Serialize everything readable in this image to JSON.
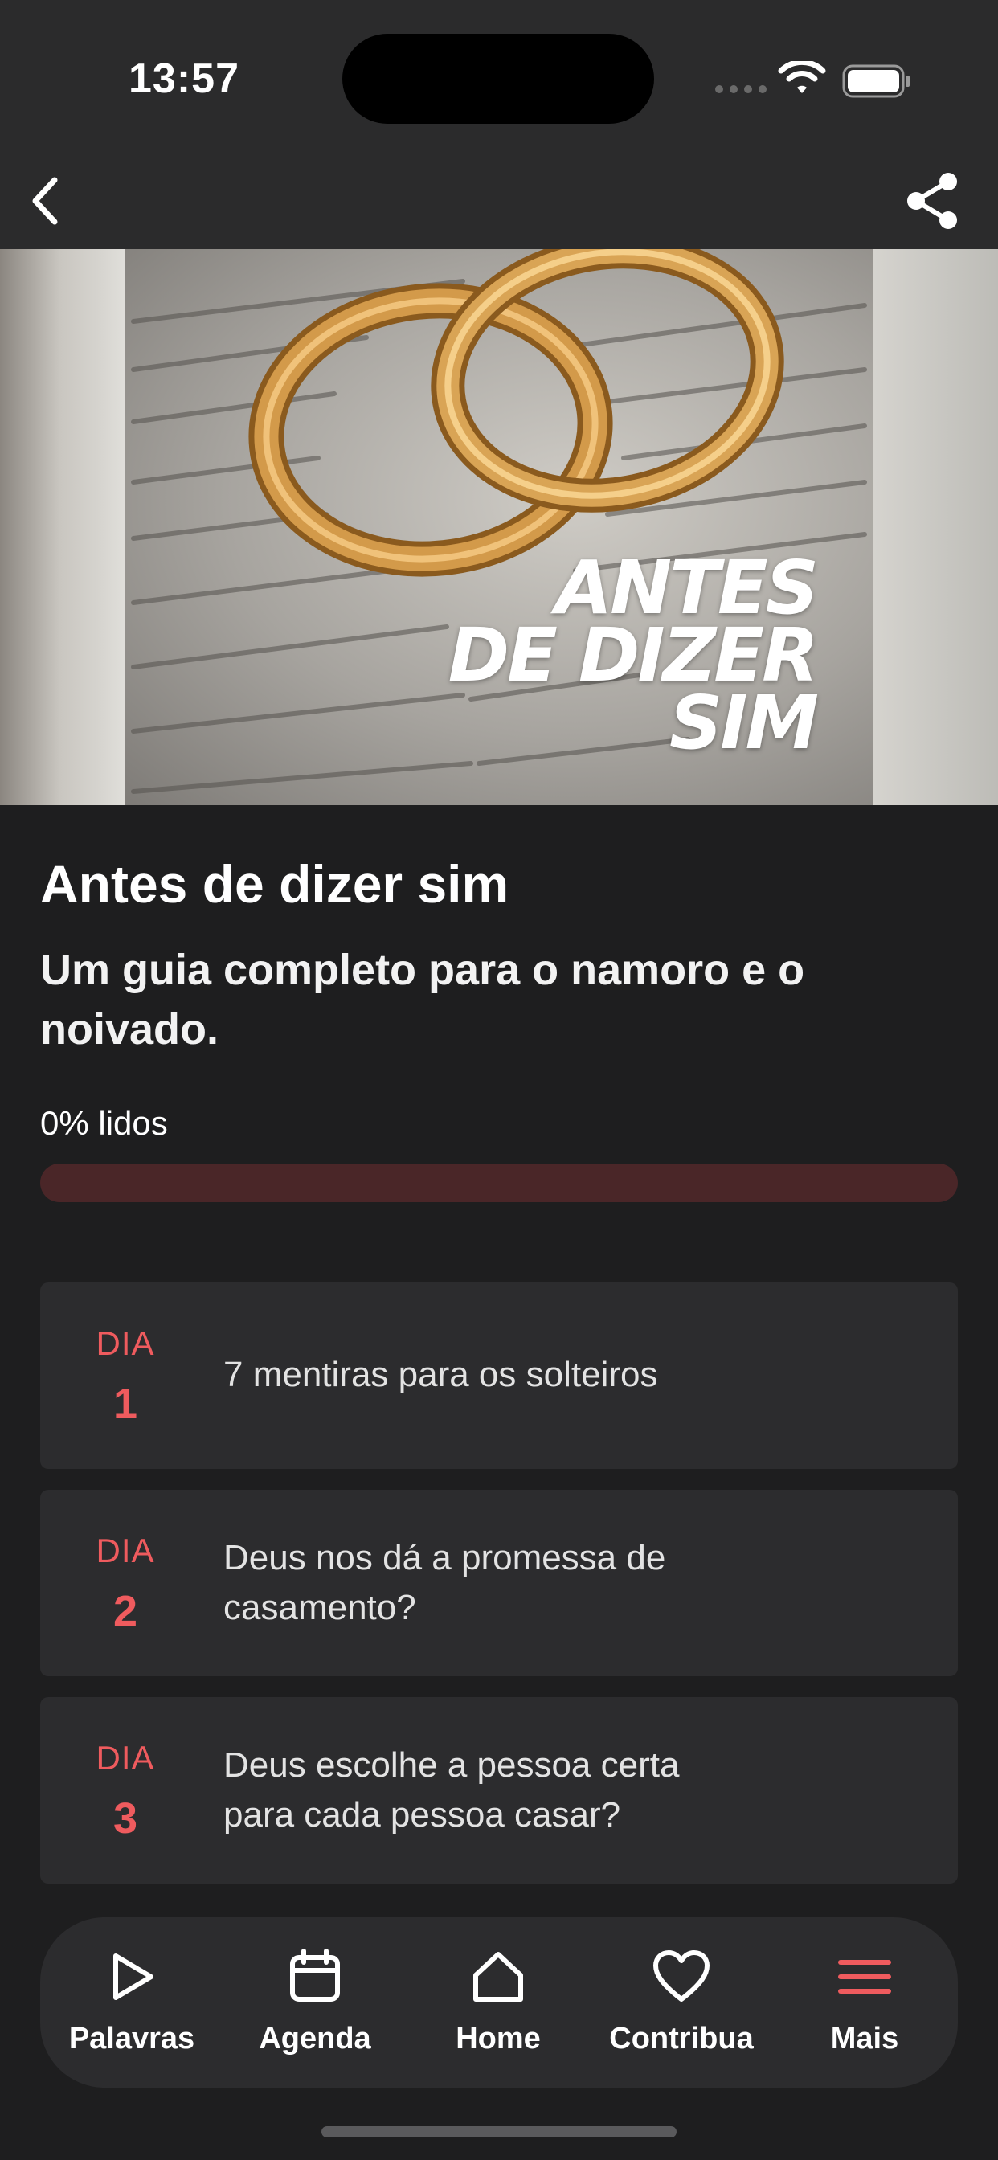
{
  "status_bar": {
    "time": "13:57"
  },
  "nav": {
    "back_icon": "chevron-left-icon",
    "share_icon": "share-icon"
  },
  "hero": {
    "cover_text_lines": [
      "ANTES",
      "DE DIZER",
      "SIM"
    ]
  },
  "plan": {
    "title": "Antes de dizer sim",
    "subtitle": "Um guia completo para o namoro e o noivado.",
    "progress_label": "0% lidos",
    "progress_value": 0
  },
  "days": [
    {
      "label": "DIA",
      "number": "1",
      "title": "7 mentiras para os solteiros"
    },
    {
      "label": "DIA",
      "number": "2",
      "title": "Deus nos dá a promessa de casamento?"
    },
    {
      "label": "DIA",
      "number": "3",
      "title": "Deus escolhe a pessoa certa para cada pessoa casar?"
    }
  ],
  "tabbar": {
    "items": [
      {
        "label": "Palavras",
        "icon": "play-icon"
      },
      {
        "label": "Agenda",
        "icon": "calendar-icon"
      },
      {
        "label": "Home",
        "icon": "home-icon"
      },
      {
        "label": "Contribua",
        "icon": "heart-icon"
      },
      {
        "label": "Mais",
        "icon": "menu-icon"
      }
    ],
    "active_index": 4
  },
  "colors": {
    "accent": "#ef5b5e",
    "background": "#1e1e1f",
    "card": "#2c2c2e",
    "progress_track": "#4a2628"
  }
}
